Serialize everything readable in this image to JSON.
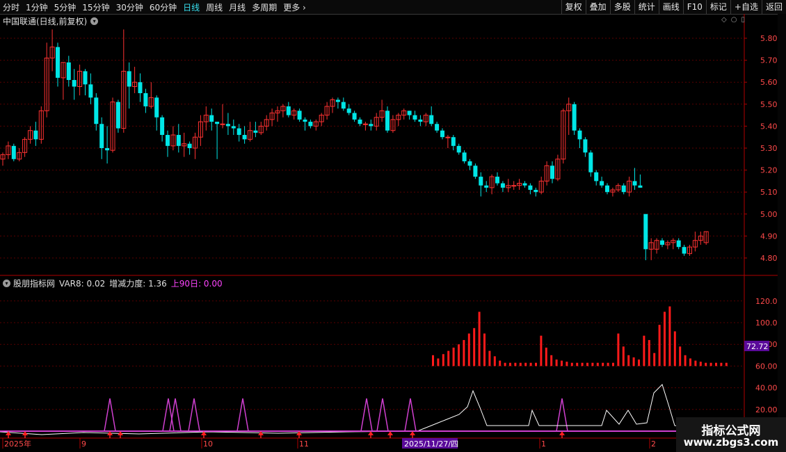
{
  "toolbar": {
    "period_tabs": [
      "分时",
      "1分钟",
      "5分钟",
      "15分钟",
      "30分钟",
      "60分钟",
      "日线",
      "周线",
      "月线",
      "多周期"
    ],
    "active_tab": "日线",
    "more_label": "更多",
    "right_tools": [
      "复权",
      "叠加",
      "多股",
      "统计",
      "画线",
      "F10",
      "标记",
      "+自选",
      "返回"
    ]
  },
  "main_chart": {
    "title": "中国联通(日线,前复权)",
    "price_axis": [
      "5.80",
      "5.70",
      "5.60",
      "5.50",
      "5.40",
      "5.30",
      "5.20",
      "5.10",
      "5.00",
      "4.90",
      "4.80"
    ],
    "colors": {
      "up": "#ff3232",
      "down": "#00e6e6",
      "grid": "#5a0000",
      "axis": "#b00000"
    }
  },
  "indicator": {
    "name": "股朋指标网",
    "var8": "VAR8: 0.02",
    "zeng": "增减力度: 1.36",
    "up90": "上90日: 0.00",
    "axis": [
      "120.0",
      "100.0",
      "80.00",
      "60.00",
      "40.00",
      "20.00"
    ],
    "current_value": "72.72",
    "colors": {
      "bar": "#ff1a1a",
      "peak": "#d040d0",
      "line": "#ffffff",
      "arrow": "#ff2020",
      "value_box": "#5a0a9a"
    }
  },
  "date_axis": {
    "labels": [
      "2025年",
      "9",
      "10",
      "11",
      "1",
      "2"
    ],
    "highlight": "2025/11/27/四"
  },
  "watermark": {
    "title": "指标公式网",
    "url": "www.zbgs3.com"
  },
  "candles": [
    [
      5.25,
      5.28,
      5.22,
      5.27
    ],
    [
      5.27,
      5.33,
      5.25,
      5.31
    ],
    [
      5.31,
      5.32,
      5.24,
      5.25
    ],
    [
      5.25,
      5.3,
      5.24,
      5.28
    ],
    [
      5.28,
      5.35,
      5.26,
      5.34
    ],
    [
      5.34,
      5.4,
      5.32,
      5.38
    ],
    [
      5.38,
      5.42,
      5.31,
      5.34
    ],
    [
      5.34,
      5.49,
      5.32,
      5.47
    ],
    [
      5.47,
      5.78,
      5.44,
      5.71
    ],
    [
      5.71,
      5.84,
      5.65,
      5.76
    ],
    [
      5.76,
      5.78,
      5.58,
      5.62
    ],
    [
      5.62,
      5.69,
      5.52,
      5.69
    ],
    [
      5.69,
      5.72,
      5.58,
      5.61
    ],
    [
      5.61,
      5.66,
      5.52,
      5.58
    ],
    [
      5.58,
      5.68,
      5.54,
      5.65
    ],
    [
      5.65,
      5.66,
      5.54,
      5.59
    ],
    [
      5.59,
      5.64,
      5.5,
      5.53
    ],
    [
      5.53,
      5.55,
      5.38,
      5.41
    ],
    [
      5.41,
      5.44,
      5.25,
      5.3
    ],
    [
      5.3,
      5.4,
      5.23,
      5.29
    ],
    [
      5.29,
      5.53,
      5.28,
      5.51
    ],
    [
      5.51,
      5.52,
      5.37,
      5.39
    ],
    [
      5.39,
      5.84,
      5.37,
      5.65
    ],
    [
      5.65,
      5.69,
      5.48,
      5.58
    ],
    [
      5.58,
      5.67,
      5.55,
      5.6
    ],
    [
      5.6,
      5.64,
      5.51,
      5.55
    ],
    [
      5.55,
      5.57,
      5.46,
      5.49
    ],
    [
      5.49,
      5.6,
      5.48,
      5.53
    ],
    [
      5.53,
      5.54,
      5.38,
      5.44
    ],
    [
      5.44,
      5.45,
      5.33,
      5.36
    ],
    [
      5.36,
      5.38,
      5.26,
      5.31
    ],
    [
      5.31,
      5.4,
      5.29,
      5.36
    ],
    [
      5.36,
      5.41,
      5.28,
      5.31
    ],
    [
      5.31,
      5.37,
      5.26,
      5.32
    ],
    [
      5.32,
      5.33,
      5.27,
      5.3
    ],
    [
      5.3,
      5.37,
      5.25,
      5.35
    ],
    [
      5.35,
      5.45,
      5.31,
      5.42
    ],
    [
      5.42,
      5.49,
      5.38,
      5.45
    ],
    [
      5.45,
      5.48,
      5.38,
      5.42
    ],
    [
      5.42,
      5.42,
      5.25,
      5.41
    ],
    [
      5.41,
      5.5,
      5.39,
      5.41
    ],
    [
      5.41,
      5.46,
      5.36,
      5.4
    ],
    [
      5.4,
      5.43,
      5.36,
      5.39
    ],
    [
      5.39,
      5.41,
      5.33,
      5.36
    ],
    [
      5.36,
      5.4,
      5.32,
      5.34
    ],
    [
      5.34,
      5.42,
      5.33,
      5.38
    ],
    [
      5.38,
      5.42,
      5.35,
      5.37
    ],
    [
      5.37,
      5.42,
      5.36,
      5.4
    ],
    [
      5.4,
      5.45,
      5.38,
      5.43
    ],
    [
      5.43,
      5.48,
      5.4,
      5.46
    ],
    [
      5.46,
      5.49,
      5.42,
      5.47
    ],
    [
      5.47,
      5.5,
      5.44,
      5.49
    ],
    [
      5.49,
      5.51,
      5.44,
      5.45
    ],
    [
      5.45,
      5.48,
      5.43,
      5.47
    ],
    [
      5.47,
      5.48,
      5.42,
      5.43
    ],
    [
      5.43,
      5.44,
      5.38,
      5.42
    ],
    [
      5.42,
      5.43,
      5.39,
      5.4
    ],
    [
      5.4,
      5.43,
      5.38,
      5.42
    ],
    [
      5.42,
      5.46,
      5.4,
      5.45
    ],
    [
      5.45,
      5.51,
      5.43,
      5.49
    ],
    [
      5.49,
      5.53,
      5.46,
      5.52
    ],
    [
      5.52,
      5.53,
      5.48,
      5.51
    ],
    [
      5.51,
      5.53,
      5.47,
      5.48
    ],
    [
      5.48,
      5.5,
      5.45,
      5.46
    ],
    [
      5.46,
      5.47,
      5.42,
      5.43
    ],
    [
      5.43,
      5.44,
      5.4,
      5.41
    ],
    [
      5.41,
      5.42,
      5.38,
      5.41
    ],
    [
      5.41,
      5.43,
      5.38,
      5.4
    ],
    [
      5.4,
      5.46,
      5.38,
      5.44
    ],
    [
      5.44,
      5.52,
      5.42,
      5.47
    ],
    [
      5.47,
      5.49,
      5.37,
      5.38
    ],
    [
      5.38,
      5.45,
      5.37,
      5.43
    ],
    [
      5.43,
      5.46,
      5.4,
      5.45
    ],
    [
      5.45,
      5.48,
      5.43,
      5.47
    ],
    [
      5.47,
      5.47,
      5.43,
      5.45
    ],
    [
      5.45,
      5.47,
      5.42,
      5.43
    ],
    [
      5.43,
      5.45,
      5.4,
      5.42
    ],
    [
      5.42,
      5.46,
      5.4,
      5.45
    ],
    [
      5.45,
      5.49,
      5.4,
      5.41
    ],
    [
      5.41,
      5.42,
      5.37,
      5.38
    ],
    [
      5.38,
      5.39,
      5.34,
      5.35
    ],
    [
      5.35,
      5.36,
      5.3,
      5.35
    ],
    [
      5.35,
      5.36,
      5.29,
      5.31
    ],
    [
      5.31,
      5.32,
      5.27,
      5.28
    ],
    [
      5.28,
      5.29,
      5.23,
      5.24
    ],
    [
      5.24,
      5.25,
      5.2,
      5.22
    ],
    [
      5.22,
      5.23,
      5.16,
      5.17
    ],
    [
      5.17,
      5.19,
      5.08,
      5.13
    ],
    [
      5.13,
      5.15,
      5.1,
      5.12
    ],
    [
      5.12,
      5.18,
      5.09,
      5.17
    ],
    [
      5.17,
      5.19,
      5.13,
      5.14
    ],
    [
      5.14,
      5.15,
      5.1,
      5.12
    ],
    [
      5.12,
      5.16,
      5.1,
      5.13
    ],
    [
      5.13,
      5.15,
      5.11,
      5.13
    ],
    [
      5.13,
      5.16,
      5.11,
      5.14
    ],
    [
      5.14,
      5.15,
      5.12,
      5.13
    ],
    [
      5.13,
      5.14,
      5.09,
      5.11
    ],
    [
      5.11,
      5.12,
      5.08,
      5.1
    ],
    [
      5.1,
      5.17,
      5.09,
      5.15
    ],
    [
      5.15,
      5.24,
      5.13,
      5.22
    ],
    [
      5.22,
      5.24,
      5.14,
      5.16
    ],
    [
      5.16,
      5.27,
      5.15,
      5.25
    ],
    [
      5.25,
      5.48,
      5.23,
      5.47
    ],
    [
      5.47,
      5.53,
      5.36,
      5.5
    ],
    [
      5.5,
      5.51,
      5.36,
      5.38
    ],
    [
      5.38,
      5.39,
      5.3,
      5.34
    ],
    [
      5.34,
      5.35,
      5.26,
      5.28
    ],
    [
      5.28,
      5.29,
      5.17,
      5.19
    ],
    [
      5.19,
      5.2,
      5.13,
      5.15
    ],
    [
      5.15,
      5.17,
      5.12,
      5.13
    ],
    [
      5.13,
      5.14,
      5.09,
      5.1
    ],
    [
      5.1,
      5.12,
      5.08,
      5.11
    ],
    [
      5.11,
      5.14,
      5.1,
      5.13
    ],
    [
      5.13,
      5.14,
      5.09,
      5.1
    ],
    [
      5.1,
      5.17,
      5.08,
      5.15
    ],
    [
      5.15,
      5.21,
      5.11,
      5.13
    ],
    [
      5.13,
      5.18,
      5.12,
      5.12
    ],
    [
      5.0,
      5.0,
      4.79,
      4.84
    ],
    [
      4.84,
      4.89,
      4.79,
      4.87
    ],
    [
      4.84,
      4.89,
      4.82,
      4.88
    ],
    [
      4.88,
      4.89,
      4.85,
      4.86
    ],
    [
      4.86,
      4.88,
      4.84,
      4.87
    ],
    [
      4.87,
      4.89,
      4.84,
      4.88
    ],
    [
      4.88,
      4.89,
      4.84,
      4.85
    ],
    [
      4.85,
      4.86,
      4.81,
      4.82
    ],
    [
      4.82,
      4.86,
      4.81,
      4.85
    ],
    [
      4.85,
      4.92,
      4.83,
      4.88
    ],
    [
      4.88,
      4.92,
      4.86,
      4.9
    ],
    [
      4.87,
      4.92,
      4.86,
      4.92
    ]
  ],
  "bars": [
    10,
    7,
    11,
    14,
    17,
    20,
    24,
    30,
    35,
    50,
    30,
    14,
    9,
    5,
    3,
    3,
    3,
    3,
    3,
    3,
    3,
    28,
    17,
    10,
    6,
    5,
    4,
    3,
    3,
    3,
    3,
    3,
    3,
    3,
    3,
    3,
    30,
    18,
    10,
    8,
    6,
    28,
    24,
    12,
    38,
    50,
    55,
    32,
    18,
    10,
    7,
    5,
    4,
    3,
    3,
    3,
    3,
    3
  ],
  "peaks": [
    158,
    242,
    252,
    279,
    349,
    527,
    550,
    590,
    808
  ],
  "arrows": [
    12,
    36,
    158,
    173,
    293,
    375,
    430,
    533,
    561,
    593,
    808
  ]
}
